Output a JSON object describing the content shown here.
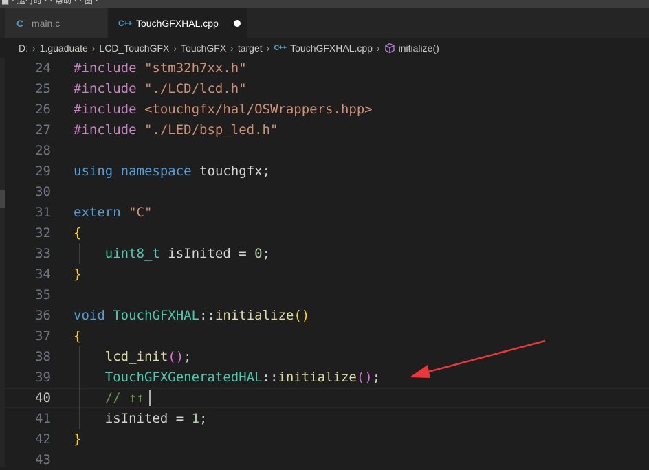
{
  "tabs": [
    {
      "label": "main.c",
      "icon": "c-file-icon",
      "active": false
    },
    {
      "label": "TouchGFXHAL.cpp",
      "icon": "cpp-file-icon",
      "active": true,
      "dirty": true
    }
  ],
  "breadcrumbs": {
    "items": [
      "D:",
      "1.guaduate",
      "LCD_TouchGFX",
      "TouchGFX",
      "target"
    ],
    "file": "TouchGFXHAL.cpp",
    "symbol": "initialize()"
  },
  "editor": {
    "current_line": 40,
    "lines": [
      {
        "no": "24",
        "tokens": [
          [
            "inc",
            "#include"
          ],
          [
            "op",
            " "
          ],
          [
            "str",
            "\"stm32h7xx.h\""
          ]
        ]
      },
      {
        "no": "25",
        "tokens": [
          [
            "inc",
            "#include"
          ],
          [
            "op",
            " "
          ],
          [
            "str",
            "\"./LCD/lcd.h\""
          ]
        ]
      },
      {
        "no": "26",
        "tokens": [
          [
            "inc",
            "#include"
          ],
          [
            "op",
            " "
          ],
          [
            "str",
            "<touchgfx/hal/OSWrappers.hpp>"
          ]
        ]
      },
      {
        "no": "27",
        "tokens": [
          [
            "inc",
            "#include"
          ],
          [
            "op",
            " "
          ],
          [
            "str",
            "\"./LED/bsp_led.h\""
          ]
        ]
      },
      {
        "no": "28",
        "tokens": []
      },
      {
        "no": "29",
        "tokens": [
          [
            "kw",
            "using"
          ],
          [
            "op",
            " "
          ],
          [
            "kw",
            "namespace"
          ],
          [
            "op",
            " "
          ],
          [
            "op",
            "touchgfx;"
          ]
        ]
      },
      {
        "no": "30",
        "tokens": []
      },
      {
        "no": "31",
        "tokens": [
          [
            "kw",
            "extern"
          ],
          [
            "op",
            " "
          ],
          [
            "str",
            "\"C\""
          ]
        ]
      },
      {
        "no": "32",
        "tokens": [
          [
            "br1",
            "{"
          ]
        ]
      },
      {
        "no": "33",
        "tokens": [
          [
            "op",
            "    "
          ],
          [
            "type",
            "uint8_t"
          ],
          [
            "op",
            " isInited = "
          ],
          [
            "num",
            "0"
          ],
          [
            "op",
            ";"
          ]
        ]
      },
      {
        "no": "34",
        "tokens": [
          [
            "br1",
            "}"
          ]
        ]
      },
      {
        "no": "35",
        "tokens": []
      },
      {
        "no": "36",
        "tokens": [
          [
            "kw",
            "void"
          ],
          [
            "op",
            " "
          ],
          [
            "type",
            "TouchGFXHAL"
          ],
          [
            "op",
            "::"
          ],
          [
            "fn",
            "initialize"
          ],
          [
            "br1",
            "()"
          ]
        ]
      },
      {
        "no": "37",
        "tokens": [
          [
            "br1",
            "{"
          ]
        ]
      },
      {
        "no": "38",
        "tokens": [
          [
            "op",
            "    "
          ],
          [
            "fn",
            "lcd_init"
          ],
          [
            "br2",
            "()"
          ],
          [
            "op",
            ";"
          ]
        ]
      },
      {
        "no": "39",
        "tokens": [
          [
            "op",
            "    "
          ],
          [
            "type",
            "TouchGFXGeneratedHAL"
          ],
          [
            "op",
            "::"
          ],
          [
            "fn",
            "initialize"
          ],
          [
            "br2",
            "()"
          ],
          [
            "op",
            ";"
          ]
        ]
      },
      {
        "no": "40",
        "tokens": [
          [
            "op",
            "    "
          ],
          [
            "cmt",
            "// ↑↑"
          ]
        ]
      },
      {
        "no": "41",
        "tokens": [
          [
            "op",
            "    isInited = "
          ],
          [
            "num",
            "1"
          ],
          [
            "op",
            ";"
          ]
        ]
      },
      {
        "no": "42",
        "tokens": [
          [
            "br1",
            "}"
          ]
        ]
      },
      {
        "no": "43",
        "tokens": []
      }
    ]
  },
  "colors": {
    "annotation_arrow": "#e8383d"
  }
}
